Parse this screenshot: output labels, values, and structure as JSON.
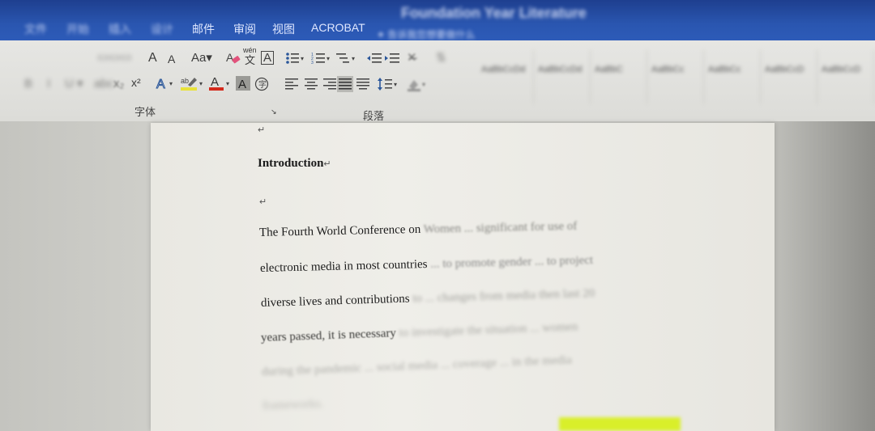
{
  "titlebar": {
    "doc_title": "Foundation Year Literature",
    "tabs": [
      "文件",
      "开始",
      "插入",
      "设计",
      "邮件",
      "审阅",
      "视图",
      "ACROBAT"
    ],
    "tell_me": "告诉我您想要做什么"
  },
  "ribbon": {
    "font_group_label": "字体",
    "paragraph_group_label": "段落",
    "grow_font": "A",
    "shrink_font": "A",
    "change_case": "Aa",
    "phonetic_top": "wén",
    "phonetic_bottom": "文",
    "char_border": "A",
    "superscript": "x²",
    "styles": [
      "AaBbCcDd",
      "AaBbCcDd",
      "AaBbC",
      "AaBbCc",
      "AaBbCc",
      "AaBbCcD",
      "AaBbCcD"
    ],
    "colors": {
      "highlight": "#e8e23a",
      "font_color": "#d42a1c",
      "accent": "#2b579a"
    }
  },
  "document": {
    "heading": "Introduction",
    "paragraph_mark": "↵",
    "lines": [
      {
        "clear": "The Fourth World Conference on ",
        "fade": "Women ... significant for  use of"
      },
      {
        "clear": "electronic media in most countries ",
        "fade": "... to   promote   gender ... to project"
      },
      {
        "clear": "diverse lives and contributions ",
        "fade": "to ... changes  from  media  then  last  20"
      },
      {
        "clear": "years passed, it is necessary ",
        "fade": "to investigate the situation ... women"
      },
      {
        "clear": "",
        "fade": "during the pandemic ... social media ... coverage ... in the media"
      },
      {
        "clear": "",
        "fade": "frameworks."
      }
    ]
  }
}
